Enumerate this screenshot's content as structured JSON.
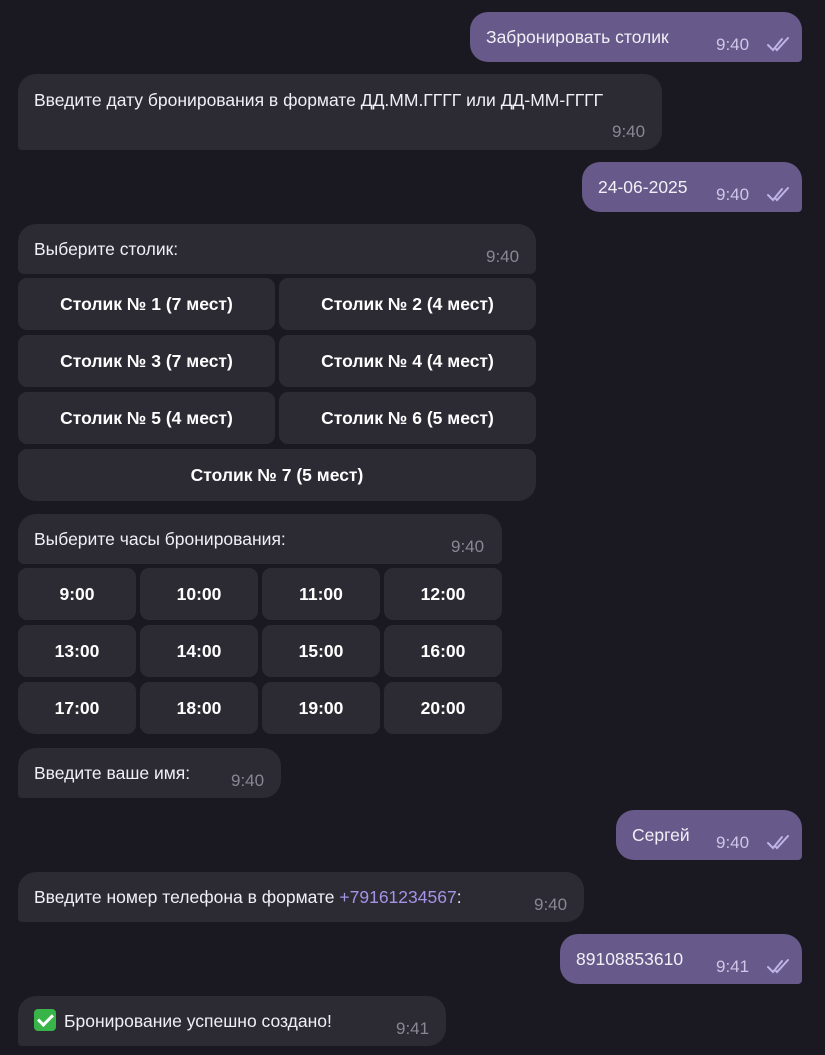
{
  "messages": {
    "m1": {
      "text": "Забронировать столик",
      "time": "9:40"
    },
    "m2": {
      "text": "Введите дату бронирования в формате ДД.ММ.ГГГГ или ДД-ММ-ГГГГ",
      "time": "9:40"
    },
    "m3": {
      "text": "24-06-2025",
      "time": "9:40"
    },
    "m4": {
      "text": "Выберите столик:",
      "time": "9:40"
    },
    "m5": {
      "text": "Выберите часы бронирования:",
      "time": "9:40"
    },
    "m6": {
      "text": "Введите ваше имя:",
      "time": "9:40"
    },
    "m7": {
      "text": "Сергей",
      "time": "9:40"
    },
    "m8": {
      "text_before": "Введите номер телефона в формате ",
      "link": "+79161234567",
      "text_after": ":",
      "time": "9:40"
    },
    "m9": {
      "text": "89108853610",
      "time": "9:41"
    },
    "m10": {
      "text": "Бронирование успешно создано!",
      "time": "9:41",
      "emoji": "check-mark-button-emoji"
    }
  },
  "tables": [
    "Столик № 1 (7 мест)",
    "Столик № 2 (4 мест)",
    "Столик № 3 (7 мест)",
    "Столик № 4 (4 мест)",
    "Столик № 5 (4 мест)",
    "Столик № 6 (5 мест)",
    "Столик № 7 (5 мест)"
  ],
  "hours": [
    "9:00",
    "10:00",
    "11:00",
    "12:00",
    "13:00",
    "14:00",
    "15:00",
    "16:00",
    "17:00",
    "18:00",
    "19:00",
    "20:00"
  ],
  "colors": {
    "background": "#1a1820",
    "incoming": "#2c2a33",
    "outgoing": "#675a8a",
    "link": "#a593e6",
    "read_checks": "#bfb4e6"
  },
  "icons": {
    "read_status": "double-check-icon"
  }
}
